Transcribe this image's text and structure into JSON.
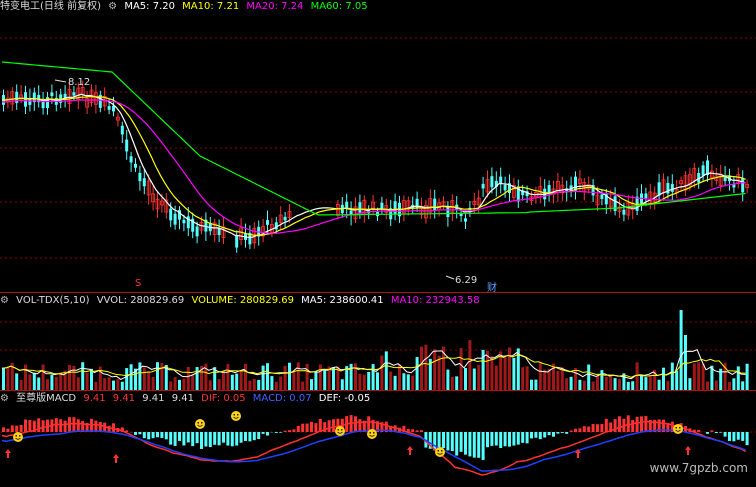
{
  "colors": {
    "up": "#ff3232",
    "down": "#54ffff",
    "ma5": "#ffffff",
    "ma10": "#ffff00",
    "ma20": "#ff00ff",
    "ma60": "#00ff00",
    "grid": "#8b0000",
    "dif": "#ff3030",
    "dea": "#2040ff",
    "def": "#ffffff"
  },
  "main_header": {
    "title": "特变电工(日线 前复权)",
    "ma5": "MA5: 7.20",
    "ma10": "MA10: 7.21",
    "ma20": "MA20: 7.24",
    "ma60": "MA60: 7.05"
  },
  "price_labels": {
    "high": "8.12",
    "low": "6.29",
    "marker_s": "S",
    "marker_cai": "财"
  },
  "volume_header": {
    "title": "VOL-TDX(5,10)",
    "vvol": "VVOL: 280829.69",
    "volume": "VOLUME: 280829.69",
    "ma5": "MA5: 238600.41",
    "ma10": "MA10: 232943.58"
  },
  "macd_header": {
    "title": "至尊版MACD",
    "v1": "9.41",
    "v2": "9.41",
    "v3": "9.41",
    "v4": "9.41",
    "dif": "DIF: 0.05",
    "macd": "MACD: 0.07",
    "def": "DEF: -0.05"
  },
  "watermark": "www.7gpzb.com",
  "icons": [
    "gear-icon",
    "smiley-icon",
    "up-arrow-icon"
  ]
}
